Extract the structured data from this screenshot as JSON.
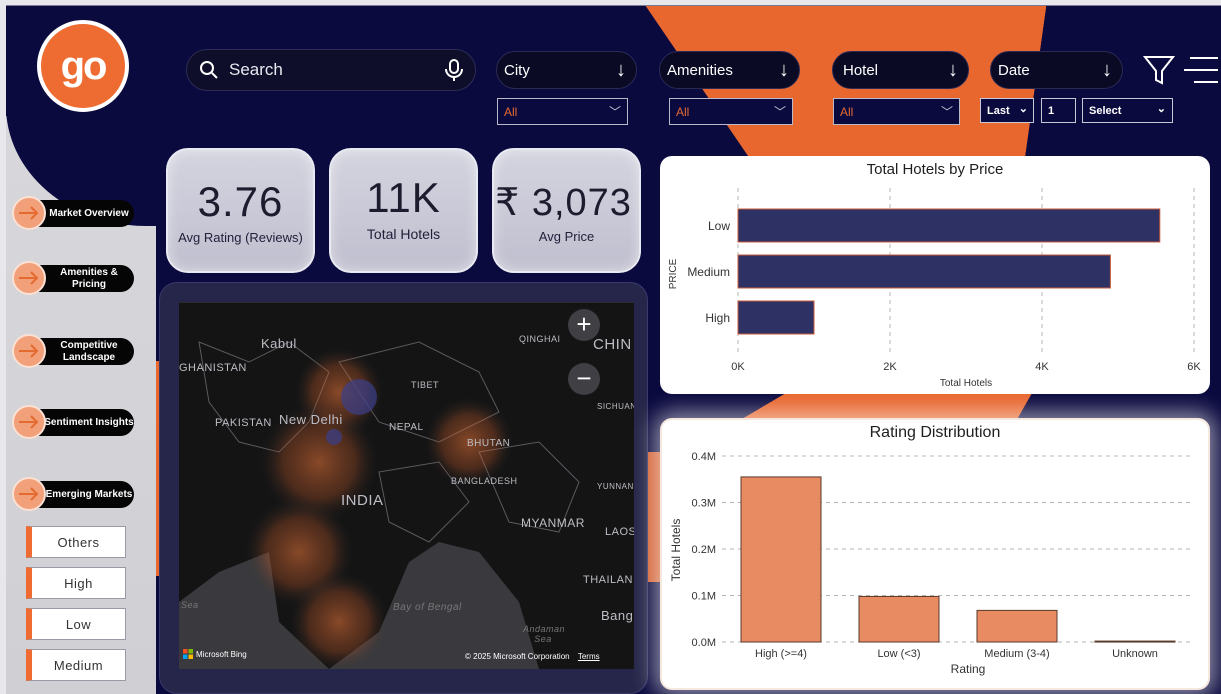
{
  "brand": {
    "logo_text": "go"
  },
  "nav": [
    {
      "label": "Market Overview"
    },
    {
      "label": "Amenities & Pricing"
    },
    {
      "label": "Competitive Landscape"
    },
    {
      "label": "Sentiment Insights"
    },
    {
      "label": "Emerging Markets"
    }
  ],
  "legend_buttons": [
    "Others",
    "High",
    "Low",
    "Medium"
  ],
  "search": {
    "placeholder": "Search"
  },
  "filters": [
    {
      "label": "City",
      "value": "All"
    },
    {
      "label": "Amenities",
      "value": "All"
    },
    {
      "label": "Hotel",
      "value": "All"
    },
    {
      "label": "Date",
      "last": "Last",
      "count": "1",
      "unit": "Select"
    }
  ],
  "kpis": [
    {
      "value": "3.76",
      "label": "Avg Rating (Reviews)"
    },
    {
      "value": "11K",
      "label": "Total Hotels"
    },
    {
      "value": "₹ 3,073",
      "label": "Avg Price"
    }
  ],
  "map": {
    "labels": [
      "Kabul",
      "GHANISTAN",
      "QINGHAI",
      "CHIN",
      "TIBET",
      "PAKISTAN",
      "New Delhi",
      "NEPAL",
      "SICHUAN",
      "BHUTAN",
      "BANGLADESH",
      "INDIA",
      "YUNNAN",
      "MYANMAR",
      "LAOS",
      "THAILAN",
      "Sea",
      "Bay of Bengal",
      "Andaman Sea",
      "Bang"
    ],
    "zoom_in": "+",
    "zoom_out": "−",
    "attribution_left": "Microsoft Bing",
    "copyright": "© 2025 Microsoft Corporation",
    "terms": "Terms"
  },
  "colors": {
    "navy": "#0b0a3f",
    "orange": "#ee6b32",
    "bar_navy": "#2e3163",
    "bar_orange": "#e98b62"
  },
  "chart_data": [
    {
      "type": "bar",
      "orientation": "horizontal",
      "title": "Total Hotels by Price",
      "xlabel": "Total Hotels",
      "ylabel": "PRICE",
      "categories": [
        "Low",
        "Medium",
        "High"
      ],
      "values": [
        5550,
        4900,
        1000
      ],
      "xlim": [
        0,
        6000
      ],
      "ticks": [
        "0K",
        "2K",
        "4K",
        "6K"
      ],
      "grid": true
    },
    {
      "type": "bar",
      "title": "Rating Distribution",
      "xlabel": "Rating",
      "ylabel": "Total Hotels",
      "categories": [
        "High (>=4)",
        "Low (<3)",
        "Medium (3-4)",
        "Unknown"
      ],
      "values": [
        0.355,
        0.098,
        0.068,
        0.002
      ],
      "ylim": [
        0,
        0.4
      ],
      "ticks": [
        "0.0M",
        "0.1M",
        "0.2M",
        "0.3M",
        "0.4M"
      ],
      "grid": true
    }
  ]
}
